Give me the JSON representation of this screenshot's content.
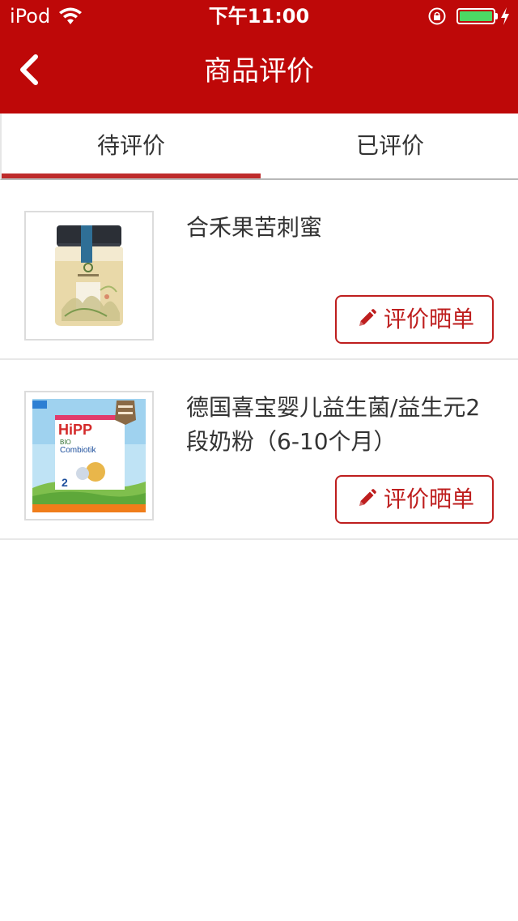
{
  "status_bar": {
    "carrier": "iPod",
    "time": "下午11:00",
    "battery_level": 1.0,
    "battery_color": "#4cd964"
  },
  "nav": {
    "title": "商品评价",
    "back_icon": "chevron-left-icon",
    "color": "#be0808"
  },
  "tabs": [
    {
      "label": "待评价",
      "active": true
    },
    {
      "label": "已评价",
      "active": false
    }
  ],
  "items": [
    {
      "name": "合禾果苦刺蜜",
      "button_label": "评价晒单",
      "button_icon": "pencil-icon",
      "image": "honey-jar-image"
    },
    {
      "name": "德国喜宝婴儿益生菌/益生元2段奶粉（6-10个月）",
      "button_label": "评价晒单",
      "button_icon": "pencil-icon",
      "image": "hipp-formula-box-image"
    }
  ],
  "accent_color": "#be1e1e"
}
